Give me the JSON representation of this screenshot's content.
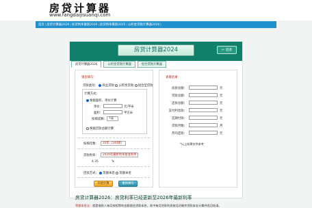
{
  "header": {
    "logo_text": "房贷计算器",
    "url_text": "www.fangdaijisuanqi.com"
  },
  "nav": {
    "items": [
      "首页",
      "房贷计算器2026",
      "房贷利率最新2026",
      "房贷利率最新2025",
      "公积金贷款计算器2026"
    ]
  },
  "panel": {
    "title": "房贷计算器2024",
    "back_label": "后退",
    "tabs": [
      "房贷计算器2026",
      "公积金贷款计算器",
      "组合贷款计算器"
    ]
  },
  "form": {
    "section_title": "请您填写：",
    "loan_type_label": "贷款类别：",
    "loan_types": [
      "商业贷款",
      "公积金贷款",
      "组合型贷款"
    ],
    "calc_method_label": "计算方式：",
    "by_area": "根据面积、单价计算",
    "unit_price_label": "单价：",
    "unit_price_unit": "元/平米",
    "area_label": "面积：",
    "area_unit": "平方米",
    "down_payment_label": "按揭成数：",
    "down_payment_value": "7成",
    "by_total": "根据贷款总额计算",
    "term_label": "按揭年数：",
    "term_value": "20年（240期）",
    "rate_label": "贷款利率：",
    "rate_select": "2026年最新利率基准利率",
    "rate_value": "4.35",
    "rate_unit": "%",
    "repay_label": "还款方式：",
    "repay_options": [
      "等额本息",
      "等额本金"
    ],
    "calc_button": "开始计算",
    "reset_button": "重新填写"
  },
  "result": {
    "section_title": "查看结果：",
    "fields": [
      {
        "label": "房款总额：",
        "unit": "元"
      },
      {
        "label": "贷款总额：",
        "unit": "元"
      },
      {
        "label": "还款总额：",
        "unit": "元"
      },
      {
        "label": "支付利息款：",
        "unit": "元"
      },
      {
        "label": "首期付款：",
        "unit": "元"
      },
      {
        "label": "贷款月数：",
        "unit": "月"
      },
      {
        "label": "月均还款：",
        "unit": "元"
      }
    ],
    "note": "*以上结果仅供参考"
  },
  "news": {
    "title": "房贷计算器2026：房贷利率已经更新至2026年最新利率",
    "lead": "等额本息法：",
    "body": "就是借款人每月按相等的金额偿还贷款本息，其中每月贷款利息按月初剩余贷款本金计算并逐月结清。"
  }
}
